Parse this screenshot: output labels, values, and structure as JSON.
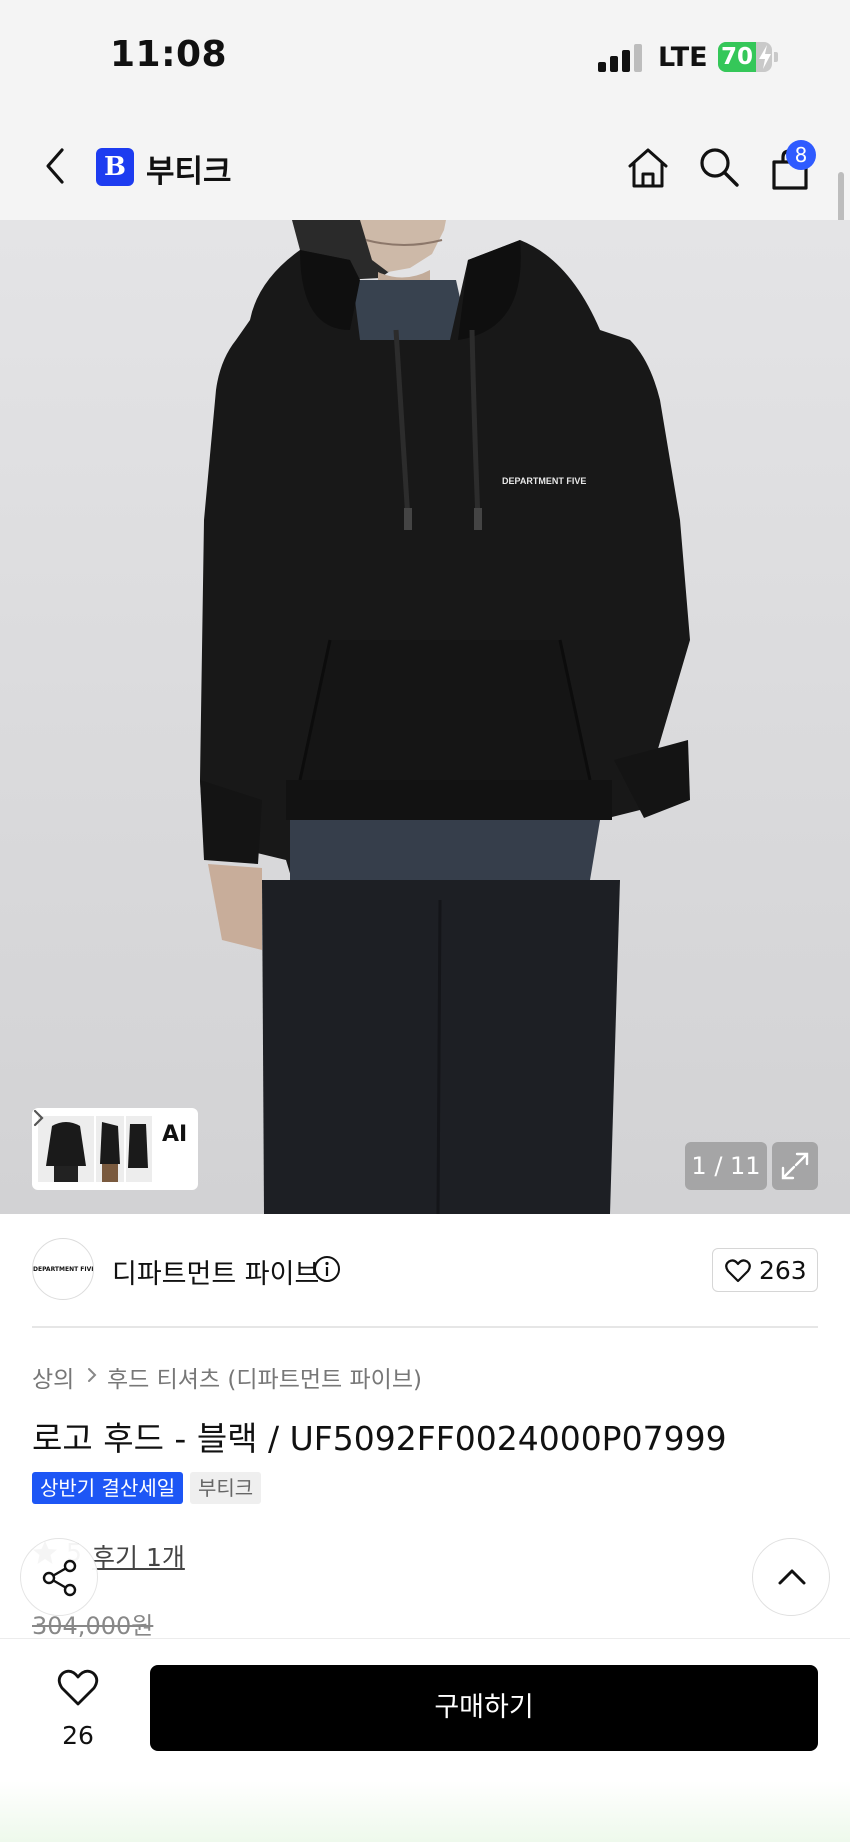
{
  "status_bar": {
    "time": "11:08",
    "network": "LTE",
    "battery_level": 70,
    "battery_label": "70"
  },
  "header": {
    "brand_badge": "B",
    "title": "부티크",
    "cart_count": "8",
    "icons": [
      "back-icon",
      "home-icon",
      "search-icon",
      "shopping-bag-icon"
    ]
  },
  "gallery": {
    "thumbnail_label": "AI",
    "counter": "1 / 11",
    "print_text": "DEPARTMENT FIVE"
  },
  "seller": {
    "logo_text": "DEPARTMENT FIVE",
    "name": "디파트먼트 파이브",
    "likes": "263"
  },
  "breadcrumb": {
    "category": "상의",
    "subcategory": "후드 티셔츠 (디파트먼트 파이브)"
  },
  "product": {
    "title": "로고 후드 - 블랙 / UF5092FF0024000P07999",
    "tags": [
      "상반기 결산세일",
      "부티크"
    ],
    "rating": "5",
    "reviews": "후기 1개",
    "original_price": "304,000원"
  },
  "bottom_bar": {
    "wishlist_count": "26",
    "buy_label": "구매하기"
  },
  "colors": {
    "brand_blue": "#1d3cf0",
    "badge_blue": "#2f5bff",
    "sale_tag": "#1d56f5",
    "battery_green": "#35c759",
    "buy_button": "#000000"
  }
}
